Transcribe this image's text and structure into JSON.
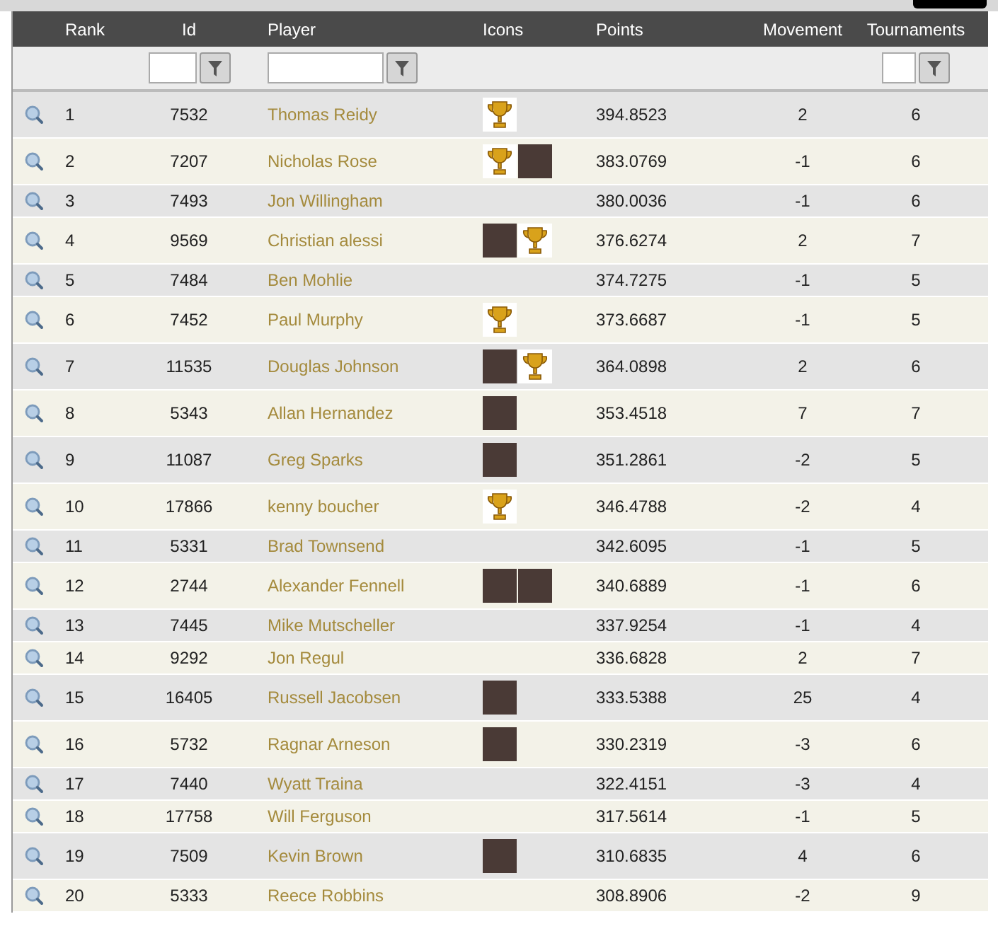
{
  "columns": [
    {
      "label": "Rank",
      "filter": false
    },
    {
      "label": "Id",
      "filter": true
    },
    {
      "label": "Player",
      "filter": true
    },
    {
      "label": "Icons",
      "filter": false
    },
    {
      "label": "Points",
      "filter": false
    },
    {
      "label": "Movement",
      "filter": false
    },
    {
      "label": "Tournaments",
      "filter": true
    }
  ],
  "rows": [
    {
      "rank": "1",
      "id": "7532",
      "player": "Thomas Reidy",
      "icons": [
        {
          "kind": "trophy"
        }
      ],
      "points": "394.8523",
      "movement": "2",
      "tournaments": "6"
    },
    {
      "rank": "2",
      "id": "7207",
      "player": "Nicholas Rose",
      "icons": [
        {
          "kind": "trophy"
        },
        {
          "kind": "portrait"
        }
      ],
      "points": "383.0769",
      "movement": "-1",
      "tournaments": "6"
    },
    {
      "rank": "3",
      "id": "7493",
      "player": "Jon Willingham",
      "icons": [],
      "points": "380.0036",
      "movement": "-1",
      "tournaments": "6"
    },
    {
      "rank": "4",
      "id": "9569",
      "player": "Christian alessi",
      "icons": [
        {
          "kind": "portrait"
        },
        {
          "kind": "trophy"
        }
      ],
      "points": "376.6274",
      "movement": "2",
      "tournaments": "7"
    },
    {
      "rank": "5",
      "id": "7484",
      "player": "Ben Mohlie",
      "icons": [],
      "points": "374.7275",
      "movement": "-1",
      "tournaments": "5"
    },
    {
      "rank": "6",
      "id": "7452",
      "player": "Paul Murphy",
      "icons": [
        {
          "kind": "trophy"
        }
      ],
      "points": "373.6687",
      "movement": "-1",
      "tournaments": "5"
    },
    {
      "rank": "7",
      "id": "11535",
      "player": "Douglas Johnson",
      "icons": [
        {
          "kind": "portrait"
        },
        {
          "kind": "trophy"
        }
      ],
      "points": "364.0898",
      "movement": "2",
      "tournaments": "6"
    },
    {
      "rank": "8",
      "id": "5343",
      "player": "Allan Hernandez",
      "icons": [
        {
          "kind": "portrait"
        }
      ],
      "points": "353.4518",
      "movement": "7",
      "tournaments": "7"
    },
    {
      "rank": "9",
      "id": "11087",
      "player": "Greg Sparks",
      "icons": [
        {
          "kind": "portrait"
        }
      ],
      "points": "351.2861",
      "movement": "-2",
      "tournaments": "5"
    },
    {
      "rank": "10",
      "id": "17866",
      "player": "kenny boucher",
      "icons": [
        {
          "kind": "trophy"
        }
      ],
      "points": "346.4788",
      "movement": "-2",
      "tournaments": "4"
    },
    {
      "rank": "11",
      "id": "5331",
      "player": "Brad Townsend",
      "icons": [],
      "points": "342.6095",
      "movement": "-1",
      "tournaments": "5"
    },
    {
      "rank": "12",
      "id": "2744",
      "player": "Alexander Fennell",
      "icons": [
        {
          "kind": "portrait"
        },
        {
          "kind": "portrait"
        }
      ],
      "points": "340.6889",
      "movement": "-1",
      "tournaments": "6"
    },
    {
      "rank": "13",
      "id": "7445",
      "player": "Mike Mutscheller",
      "icons": [],
      "points": "337.9254",
      "movement": "-1",
      "tournaments": "4"
    },
    {
      "rank": "14",
      "id": "9292",
      "player": "Jon Regul",
      "icons": [],
      "points": "336.6828",
      "movement": "2",
      "tournaments": "7"
    },
    {
      "rank": "15",
      "id": "16405",
      "player": "Russell Jacobsen",
      "icons": [
        {
          "kind": "portrait"
        }
      ],
      "points": "333.5388",
      "movement": "25",
      "tournaments": "4"
    },
    {
      "rank": "16",
      "id": "5732",
      "player": "Ragnar Arneson",
      "icons": [
        {
          "kind": "portrait"
        }
      ],
      "points": "330.2319",
      "movement": "-3",
      "tournaments": "6"
    },
    {
      "rank": "17",
      "id": "7440",
      "player": "Wyatt Traina",
      "icons": [],
      "points": "322.4151",
      "movement": "-3",
      "tournaments": "4"
    },
    {
      "rank": "18",
      "id": "17758",
      "player": "Will Ferguson",
      "icons": [],
      "points": "317.5614",
      "movement": "-1",
      "tournaments": "5"
    },
    {
      "rank": "19",
      "id": "7509",
      "player": "Kevin Brown",
      "icons": [
        {
          "kind": "portrait"
        }
      ],
      "points": "310.6835",
      "movement": "4",
      "tournaments": "6"
    },
    {
      "rank": "20",
      "id": "5333",
      "player": "Reece Robbins",
      "icons": [],
      "points": "308.8906",
      "movement": "-2",
      "tournaments": "9"
    }
  ]
}
